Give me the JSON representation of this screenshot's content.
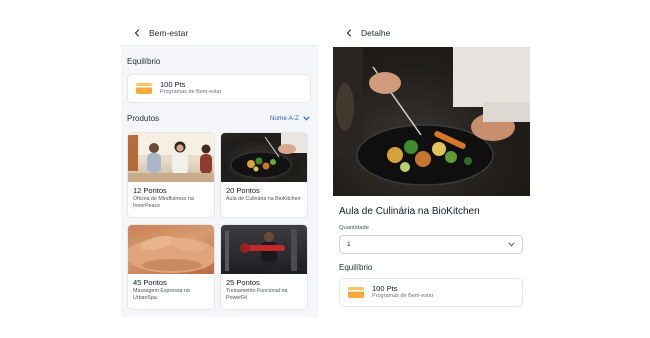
{
  "left_screen": {
    "title": "Bem-estar",
    "balance_section": "Equilíbrio",
    "balance": {
      "value": "100 Pts",
      "program": "Programas de Bem-estar"
    },
    "products_section": "Produtos",
    "sort_label": "Nome A-Z",
    "products": [
      {
        "title": "12 Pontos",
        "description": "Oficina de Mindfulness na InnerPeace",
        "image": "meditation-group-photo"
      },
      {
        "title": "20 Pontos",
        "description": "Aula de Culinária na BioKitchen",
        "image": "plated-dish-photo"
      },
      {
        "title": "45 Pontos",
        "description": "Massagem Expressa no UrbanSpa",
        "image": "massage-photo"
      },
      {
        "title": "25 Pontos",
        "description": "Treinamento Funcional na PowerFit",
        "image": "gym-training-photo"
      }
    ]
  },
  "right_screen": {
    "title": "Detalhe",
    "product_title": "Aula de Culinária na BioKitchen",
    "quantity_label": "Quantidade",
    "quantity_value": "1",
    "balance_section": "Equilíbrio",
    "balance": {
      "value": "100 Pts",
      "program": "Programas de Bem-estar"
    }
  },
  "colors": {
    "accent": "#2563eb",
    "panel_background": "#f4f6f9",
    "points_icon": "#f6a93b"
  }
}
